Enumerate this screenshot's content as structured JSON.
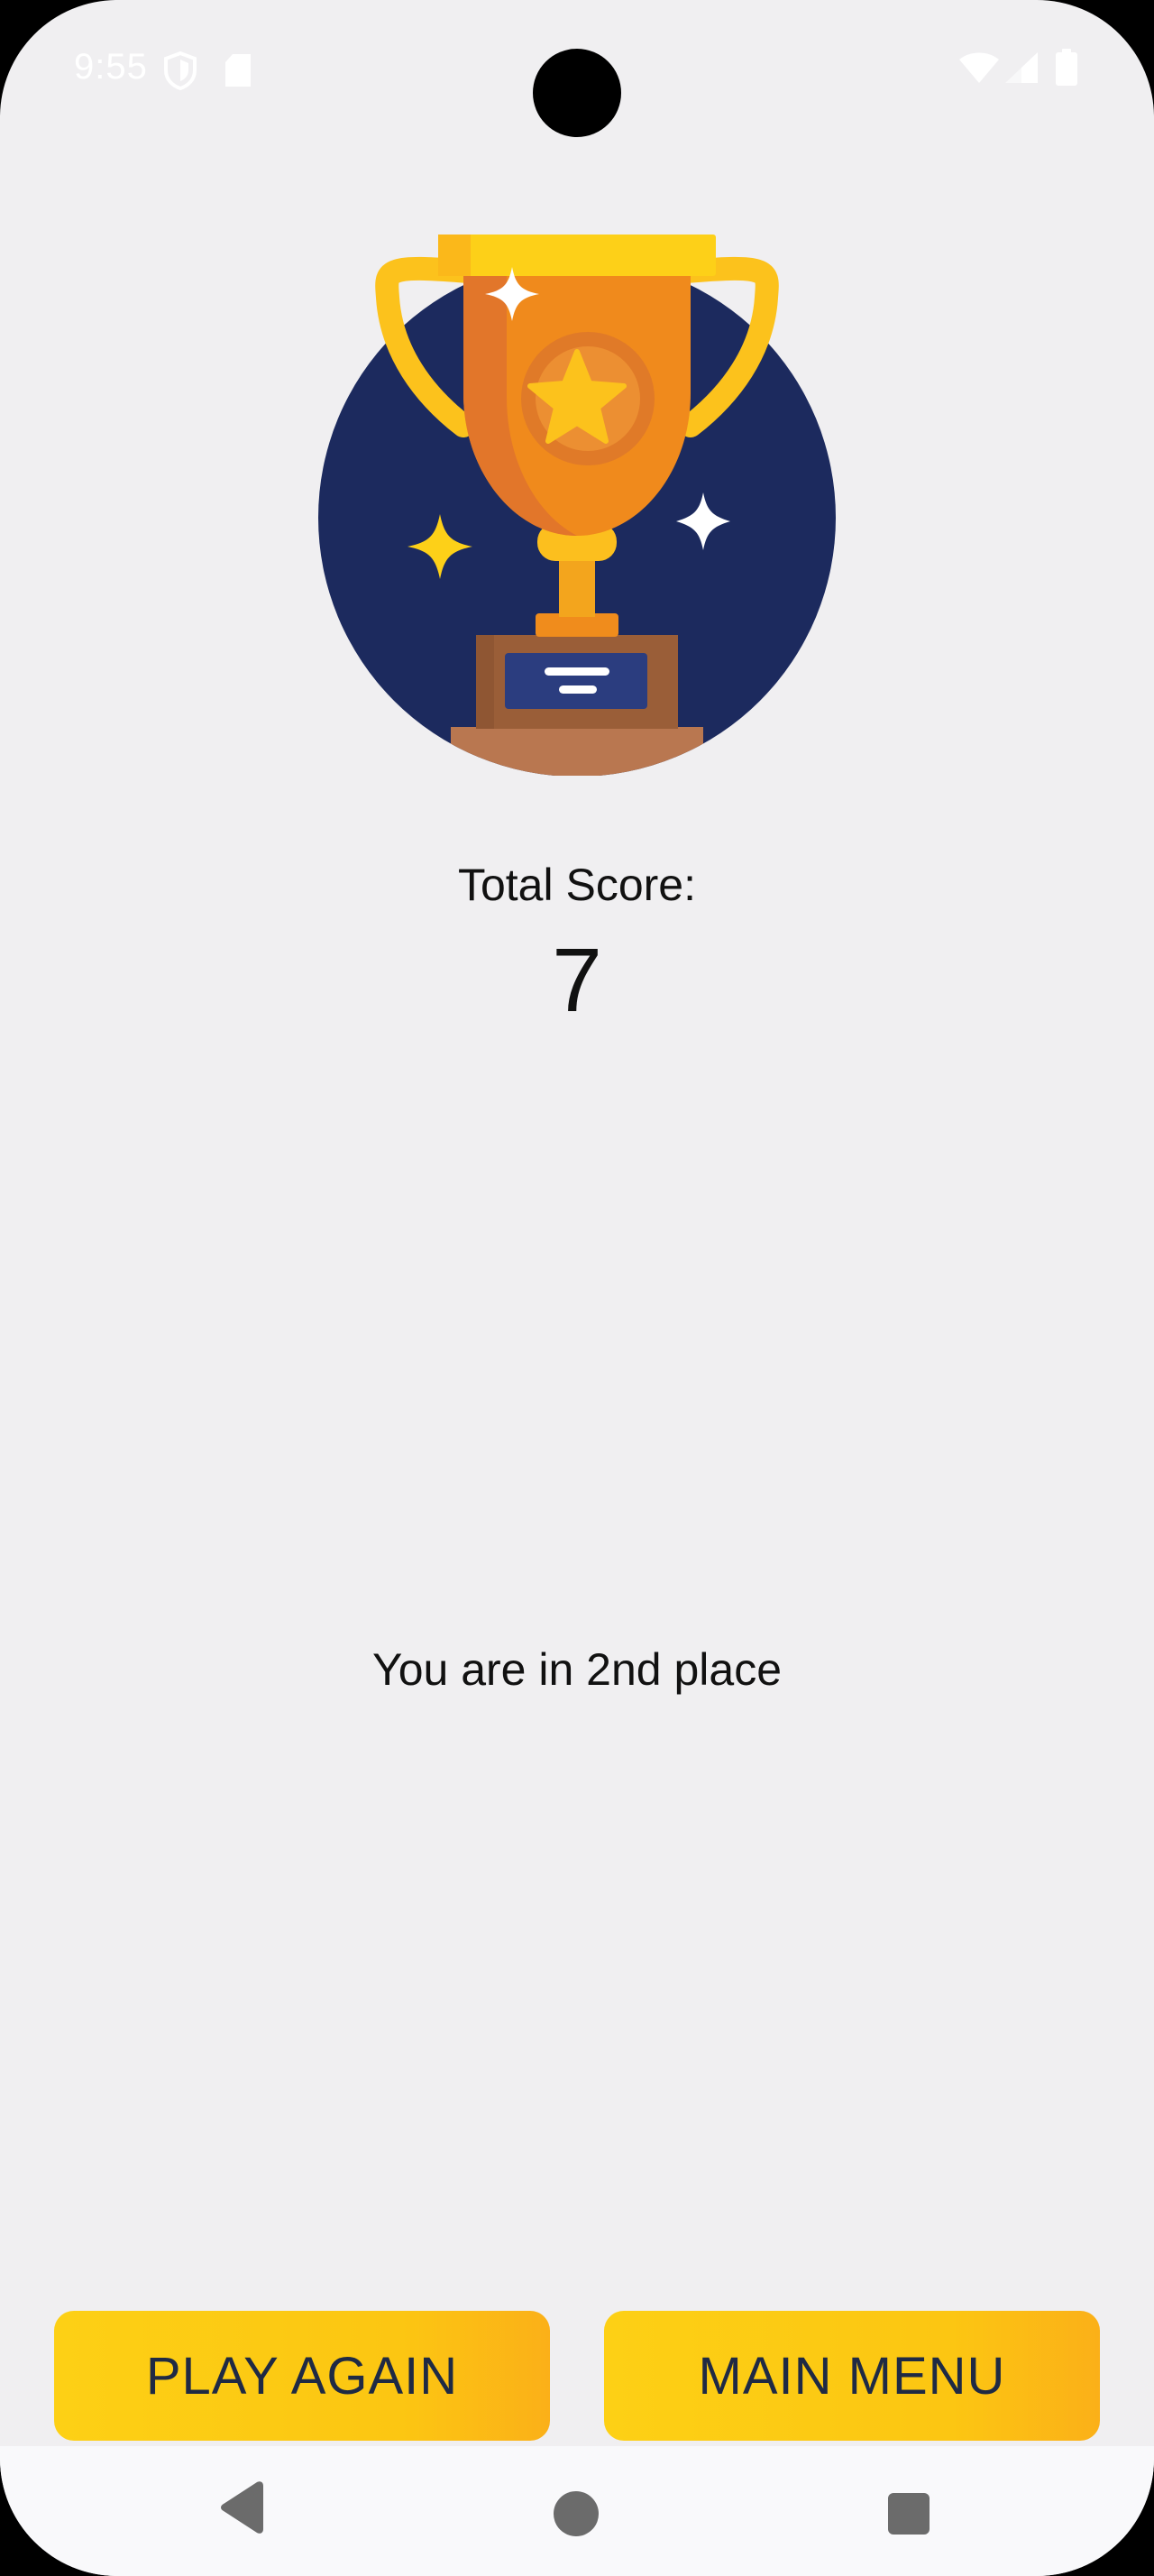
{
  "status_bar": {
    "time": "9:55",
    "icons": [
      "shield-icon",
      "sd-card-icon",
      "wifi-icon",
      "cell-signal-icon",
      "battery-icon"
    ]
  },
  "results": {
    "score_label": "Total Score:",
    "score_value": "7",
    "place_text": "You are in 2nd place"
  },
  "buttons": {
    "play_again": "PLAY AGAIN",
    "main_menu": "MAIN MENU"
  },
  "navigation": {
    "icons": [
      "back-icon",
      "home-icon",
      "recents-icon"
    ]
  },
  "colors": {
    "background": "#f0eff1",
    "button_gradient_start": "#fdd015",
    "button_gradient_end": "#fbb018",
    "button_text": "#1f2a44",
    "trophy_badge": "#1c2a5e"
  }
}
